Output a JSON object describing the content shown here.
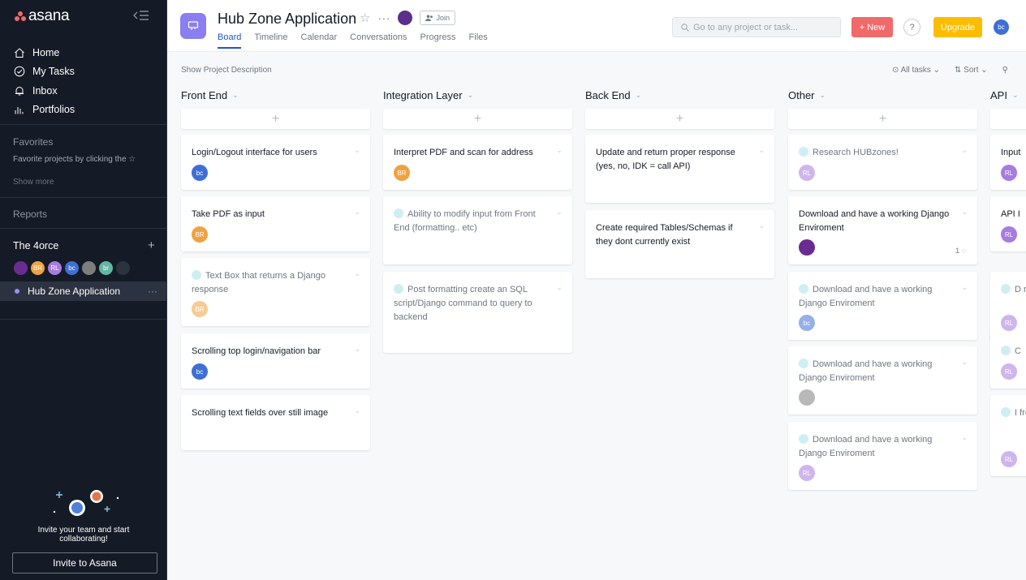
{
  "sidebar": {
    "logo": "asana",
    "nav": [
      {
        "label": "Home",
        "icon": "home-icon"
      },
      {
        "label": "My Tasks",
        "icon": "check-circle-icon"
      },
      {
        "label": "Inbox",
        "icon": "bell-icon"
      },
      {
        "label": "Portfolios",
        "icon": "bar-chart-icon"
      }
    ],
    "favorites_title": "Favorites",
    "favorites_hint": "Favorite projects by clicking the ☆",
    "show_more": "Show more",
    "reports_title": "Reports",
    "team": {
      "name": "The 4orce",
      "plus": "+",
      "members": [
        {
          "initials": "",
          "color": "#6a2c91"
        },
        {
          "initials": "BR",
          "color": "#f0a241"
        },
        {
          "initials": "RL",
          "color": "#a77be0"
        },
        {
          "initials": "bc",
          "color": "#3f6fd4"
        },
        {
          "initials": "",
          "color": "#7d7d7d"
        },
        {
          "initials": "br",
          "color": "#62b8a3"
        },
        {
          "initials": "",
          "color": "#2c3340"
        }
      ]
    },
    "project": {
      "name": "Hub Zone Application",
      "more": "···"
    },
    "invite_text_1": "Invite your team and start",
    "invite_text_2": "collaborating!",
    "invite_button": "Invite to Asana"
  },
  "header": {
    "title": "Hub Zone Application",
    "star": "☆",
    "more": "···",
    "join": "Join",
    "tabs": [
      "Board",
      "Timeline",
      "Calendar",
      "Conversations",
      "Progress",
      "Files"
    ],
    "search_placeholder": "Go to any project or task...",
    "new_button": "+ New",
    "help": "?",
    "upgrade": "Upgrade",
    "user_initials": "bc"
  },
  "toolbar": {
    "show_description": "Show Project Description",
    "all_tasks": "All tasks",
    "sort": "Sort"
  },
  "colors": {
    "sidebar_bg": "#151b26",
    "accent_blue": "#1d58c9",
    "new_red": "#f06a6a",
    "upgrade_yellow": "#fcbd01",
    "project_purple": "#8a7ef0"
  },
  "columns": [
    {
      "name": "Front End",
      "cards": [
        {
          "text": "Login/Logout interface for users",
          "done": false,
          "av": "bc",
          "color": "#3f6fd4"
        },
        {
          "text": "Take PDF as input",
          "done": false,
          "av": "BR",
          "color": "#f0a241"
        },
        {
          "text": "Text Box that returns a Django response",
          "done": true,
          "av": "BR",
          "color": "#f0a241"
        },
        {
          "text": "Scrolling top login/navigation bar",
          "done": false,
          "av": "bc",
          "color": "#3f6fd4"
        },
        {
          "text": "Scrolling text fields over still image",
          "done": false,
          "av": "",
          "color": ""
        }
      ]
    },
    {
      "name": "Integration Layer",
      "cards": [
        {
          "text": "Interpret PDF and scan for address",
          "done": false,
          "av": "BR",
          "color": "#f0a241"
        },
        {
          "text": "Ability to modify input from Front End (formatting.. etc)",
          "done": true,
          "av": "",
          "color": ""
        },
        {
          "text": "Post formatting create an SQL script/Django command to query to backend",
          "done": true,
          "av": "",
          "color": ""
        }
      ]
    },
    {
      "name": "Back End",
      "cards": [
        {
          "text": "Update and return proper response (yes, no, IDK = call API)",
          "done": false,
          "av": "",
          "color": ""
        },
        {
          "text": "Create required Tables/Schemas if they dont currently exist",
          "done": false,
          "av": "",
          "color": ""
        }
      ]
    },
    {
      "name": "Other",
      "cards": [
        {
          "text": "Research HUBzones!",
          "done": true,
          "av": "RL",
          "color": "#a77be0"
        },
        {
          "text": "Download and have a working Django Enviroment",
          "done": false,
          "av": "",
          "color": "#6a2c91",
          "comments": "1"
        },
        {
          "text": "Download and have a working Django Enviroment",
          "done": true,
          "av": "bc",
          "color": "#3f6fd4"
        },
        {
          "text": "Download and have a working Django Enviroment",
          "done": true,
          "av": "",
          "color": "#7d7d7d"
        },
        {
          "text": "Download and have a working Django Enviroment",
          "done": true,
          "av": "RL",
          "color": "#a77be0"
        }
      ]
    },
    {
      "name": "API",
      "cards": [
        {
          "text": "Input",
          "done": false,
          "av": "RL",
          "color": "#a77be0"
        },
        {
          "text": "API I",
          "done": false,
          "av": "RL",
          "color": "#a77be0"
        },
        {
          "text": "D rese",
          "done": true,
          "av": "RL",
          "color": "#a77be0"
        },
        {
          "text": "C",
          "done": true,
          "av": "RL",
          "color": "#a77be0"
        },
        {
          "text": "I from end)",
          "done": true,
          "av": "RL",
          "color": "#a77be0"
        }
      ]
    }
  ]
}
